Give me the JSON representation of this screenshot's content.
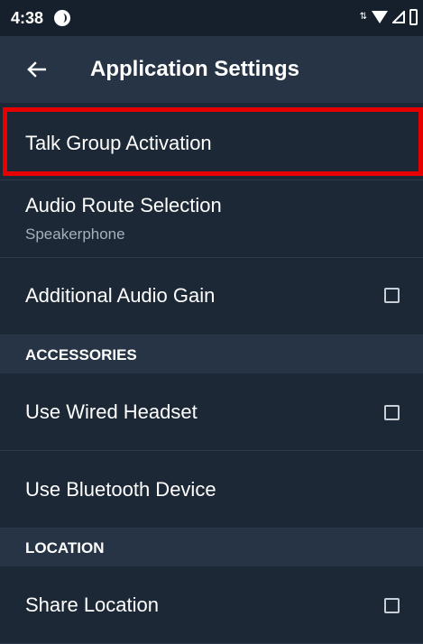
{
  "status_bar": {
    "time": "4:38"
  },
  "app_bar": {
    "title": "Application Settings"
  },
  "settings": {
    "talk_group": {
      "label": "Talk Group Activation"
    },
    "audio_route": {
      "label": "Audio Route Selection",
      "value": "Speakerphone"
    },
    "audio_gain": {
      "label": "Additional Audio Gain",
      "checked": false
    },
    "accessories_header": "ACCESSORIES",
    "wired_headset": {
      "label": "Use Wired Headset",
      "checked": false
    },
    "bluetooth": {
      "label": "Use Bluetooth Device"
    },
    "location_header": "LOCATION",
    "share_location": {
      "label": "Share Location",
      "checked": false
    }
  },
  "colors": {
    "background": "#1c2836",
    "app_bar": "#263445",
    "highlight": "#e60000"
  }
}
